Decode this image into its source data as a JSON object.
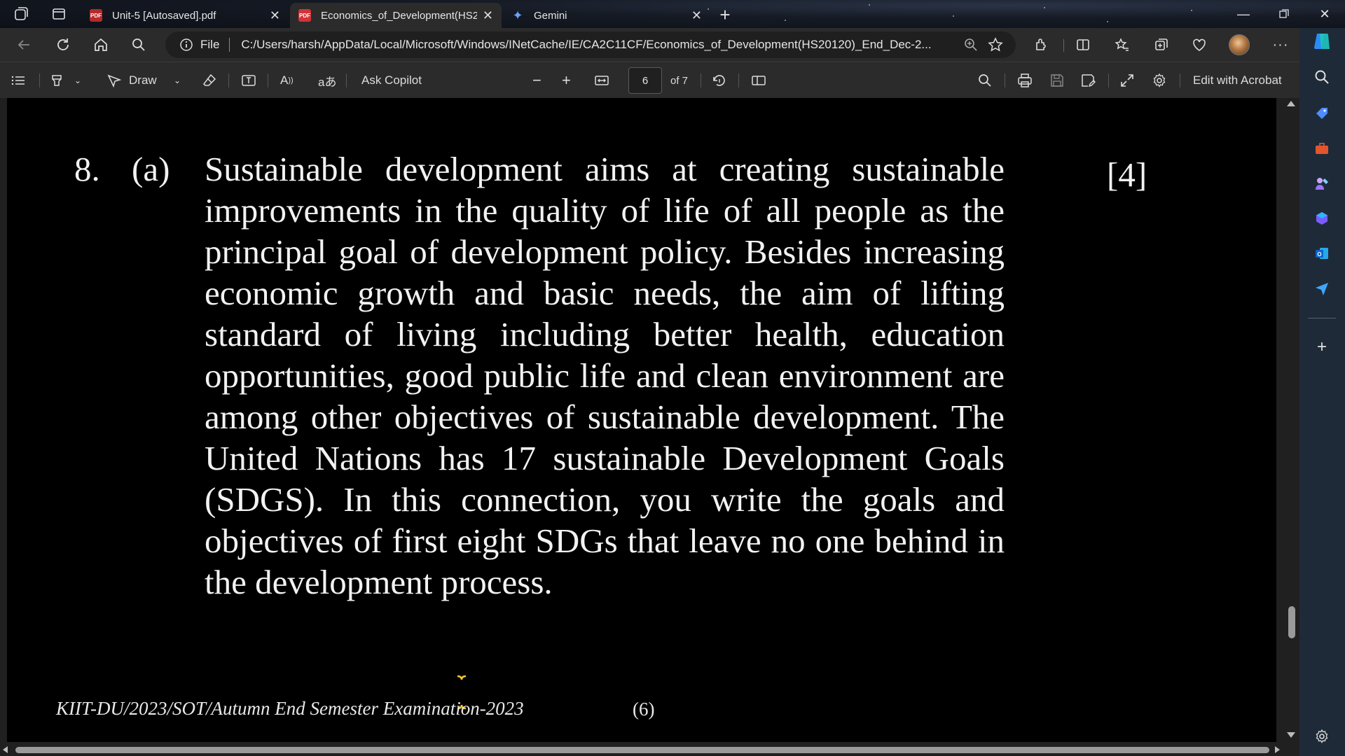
{
  "tabs": [
    {
      "title": "Unit-5 [Autosaved].pdf",
      "active": false,
      "favicon": "pdf-icon"
    },
    {
      "title": "Economics_of_Development(HS2",
      "active": true,
      "favicon": "pdf-icon"
    },
    {
      "title": "Gemini",
      "active": false,
      "favicon": "gemini-sparkle-icon"
    }
  ],
  "address": {
    "scheme_label": "File",
    "url": "C:/Users/harsh/AppData/Local/Microsoft/Windows/INetCache/IE/CA2C11CF/Economics_of_Development(HS20120)_End_Dec-2..."
  },
  "pdf_toolbar": {
    "draw_label": "Draw",
    "ask_copilot_label": "Ask Copilot",
    "current_page": "6",
    "page_total": "of 7",
    "edit_label": "Edit with Acrobat"
  },
  "document": {
    "question_number": "8.",
    "question_part": "(a)",
    "marks": "[4]",
    "body": "Sustainable development aims at creating sustainable improvements in the quality of life of all people as the principal goal of development policy. Besides increasing economic growth and basic needs, the aim of lifting standard of living including better health, education opportunities, good public life and clean environment are among other objectives of sustainable development. The United Nations has 17 sustainable Development Goals (SDGS). In this connection, you write the goals and objectives of first eight SDGs that leave no one behind in the development process.",
    "footer_left": "KIIT-DU/2023/SOT/Autumn End Semester Examination-2023",
    "footer_page": "(6)"
  },
  "colors": {
    "accent": "#4a9eff",
    "page_bg": "#000000",
    "chrome_bg": "#2b2b2b"
  }
}
